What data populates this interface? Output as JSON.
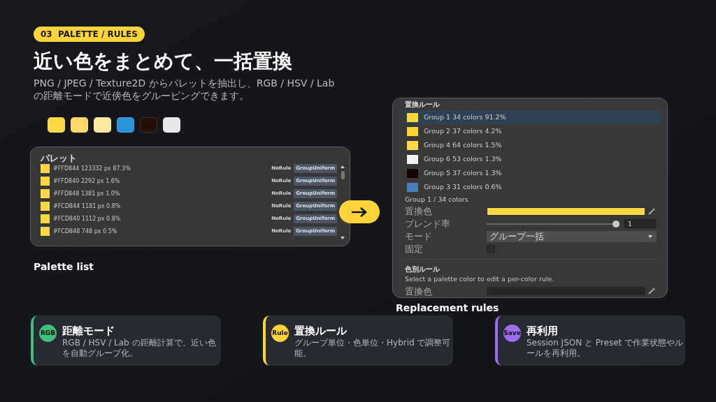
{
  "badge": "03  PALETTE / RULES",
  "title": "近い色をまとめて、一括置換",
  "description": "PNG / JPEG / Texture2D からパレットを抽出し、RGB / HSV / Lab の距離モードで近傍色をグルーピングできます。",
  "swatches": [
    {
      "color": "#ffd844"
    },
    {
      "color": "#ffd86a"
    },
    {
      "color": "#ffe8a0"
    },
    {
      "color": "#2b93dc"
    },
    {
      "color": "#231008"
    },
    {
      "color": "#e8e8e8"
    }
  ],
  "palette_panel": {
    "header": "パレット",
    "caption": "Palette list",
    "rows": [
      {
        "color": "#ffd844",
        "text": "#FFD844 123332 px 87.3%",
        "rule": "NoRule",
        "mode": "GroupUniform"
      },
      {
        "color": "#ffd840",
        "text": "#FFD840 2292 px 1.6%",
        "rule": "NoRule",
        "mode": "GroupUniform"
      },
      {
        "color": "#ffd848",
        "text": "#FFD848 1381 px 1.0%",
        "rule": "NoRule",
        "mode": "GroupUniform"
      },
      {
        "color": "#fcd844",
        "text": "#FCD844 1181 px 0.8%",
        "rule": "NoRule",
        "mode": "GroupUniform"
      },
      {
        "color": "#fcd840",
        "text": "#FCD840 1112 px 0.8%",
        "rule": "NoRule",
        "mode": "GroupUniform"
      },
      {
        "color": "#fcd848",
        "text": "#FCD848 748 px 0.5%",
        "rule": "NoRule",
        "mode": "GroupUniform"
      }
    ]
  },
  "rules_panel": {
    "header": "置換ルール",
    "caption": "Replacement rules",
    "groups": [
      {
        "color": "#ffd83c",
        "text": "Group 1 34 colors 91.2%",
        "selected": true
      },
      {
        "color": "#ffd42e",
        "text": "Group 2 37 colors 4.2%",
        "selected": false
      },
      {
        "color": "#ffd84e",
        "text": "Group 4 64 colors 1.5%",
        "selected": false
      },
      {
        "color": "#f2f2f2",
        "text": "Group 6 53 colors 1.3%",
        "selected": false
      },
      {
        "color": "#120604",
        "text": "Group 5 37 colors 1.3%",
        "selected": false
      },
      {
        "color": "#4a80b8",
        "text": "Group 3 31 colors 0.6%",
        "selected": false
      }
    ],
    "group_title": "Group 1 / 34 colors",
    "fields": [
      {
        "kind": "color",
        "label": "置換色",
        "color": "#ffd844"
      },
      {
        "kind": "slider",
        "label": "ブレンド率",
        "level": 1,
        "value": "1"
      },
      {
        "kind": "dropdown",
        "label": "モード",
        "value": "グループ一括"
      },
      {
        "kind": "checkbox",
        "label": "固定",
        "checked": false
      }
    ],
    "per_color_header": "色別ルール",
    "per_color_hint": "Select a palette color to edit a per-color rule.",
    "per_color_fields": [
      {
        "kind": "color",
        "label": "置換色"
      }
    ]
  },
  "cards": [
    {
      "icon": "RGB",
      "color": "#3fbf7f",
      "title": "距離モード",
      "text": "RGB / HSV / Lab の距離計算で、近い色を自動グループ化。"
    },
    {
      "icon": "Rule",
      "color": "#ffd43b",
      "title": "置換ルール",
      "text": "グループ単位・色単位・Hybrid で調整可能。"
    },
    {
      "icon": "Save",
      "color": "#9d6cf0",
      "title": "再利用",
      "text": "Session JSON と Preset で作業状態やルールを再利用。"
    }
  ]
}
